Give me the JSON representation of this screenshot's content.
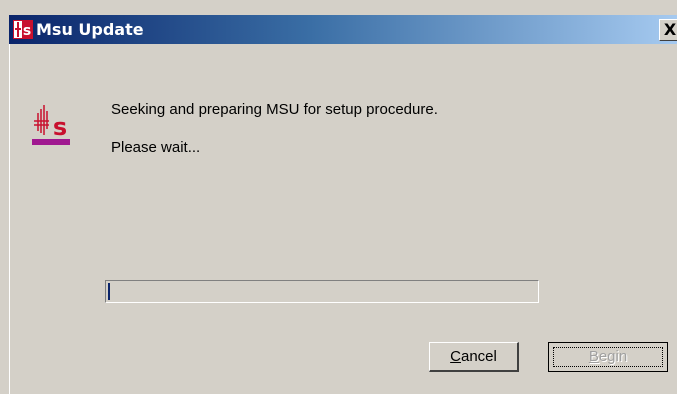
{
  "window": {
    "title": "Msu Update",
    "app_icon": "msu-logo-icon",
    "close_label": "X"
  },
  "content": {
    "message_line1": "Seeking and preparing MSU for setup procedure.",
    "message_line2": "Please wait..."
  },
  "progress": {
    "fraction": 0.0
  },
  "buttons": {
    "cancel_mnemonic": "C",
    "cancel_rest": "ancel",
    "begin_mnemonic": "B",
    "begin_rest": "egin",
    "begin_enabled": false
  },
  "colors": {
    "title_gradient_start": "#0a246a",
    "title_gradient_end": "#a6caf0",
    "logo_red": "#c8102e",
    "logo_purple": "#a01890",
    "dialog_face": "#d4d0c8"
  }
}
